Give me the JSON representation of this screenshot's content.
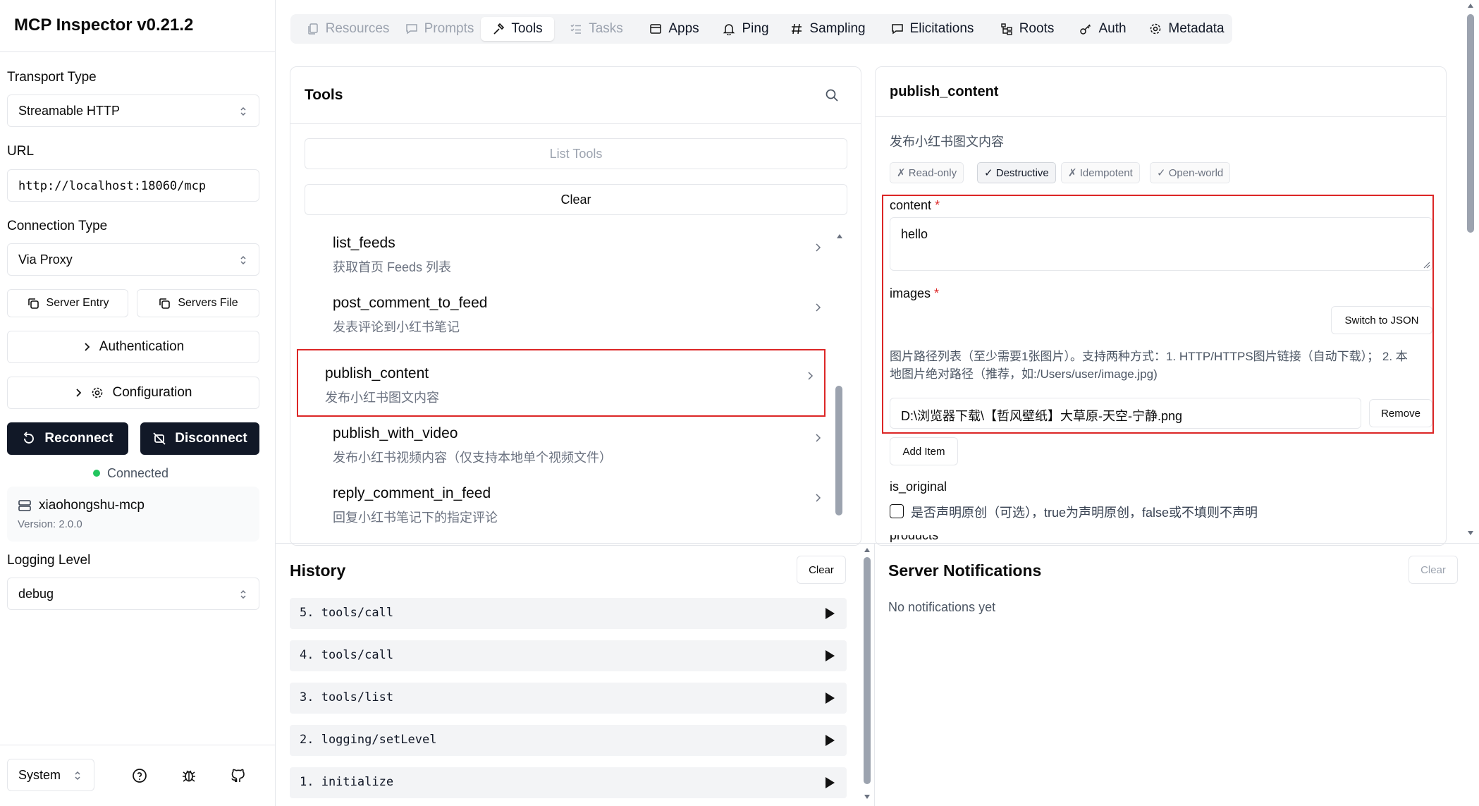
{
  "app": {
    "title": "MCP Inspector v0.21.2"
  },
  "sidebar": {
    "transport_label": "Transport Type",
    "transport_value": "Streamable HTTP",
    "url_label": "URL",
    "url_value": "http://localhost:18060/mcp",
    "connection_label": "Connection Type",
    "connection_value": "Via Proxy",
    "server_entry_label": "Server Entry",
    "servers_file_label": "Servers File",
    "authentication_label": "Authentication",
    "configuration_label": "Configuration",
    "reconnect_label": "Reconnect",
    "disconnect_label": "Disconnect",
    "status_text": "Connected",
    "server_name": "xiaohongshu-mcp",
    "server_version": "Version: 2.0.0",
    "logging_label": "Logging Level",
    "logging_value": "debug",
    "theme_value": "System"
  },
  "tabs": [
    {
      "label": "Resources",
      "icon": "resources-icon",
      "state": "disabled"
    },
    {
      "label": "Prompts",
      "icon": "prompts-icon",
      "state": "disabled"
    },
    {
      "label": "Tools",
      "icon": "hammer-icon",
      "state": "active"
    },
    {
      "label": "Tasks",
      "icon": "tasks-icon",
      "state": "disabled"
    },
    {
      "label": "Apps",
      "icon": "apps-icon",
      "state": "enabled"
    },
    {
      "label": "Ping",
      "icon": "bell-icon",
      "state": "enabled"
    },
    {
      "label": "Sampling",
      "icon": "hash-icon",
      "state": "enabled"
    },
    {
      "label": "Elicitations",
      "icon": "message-icon",
      "state": "enabled"
    },
    {
      "label": "Roots",
      "icon": "folder-tree-icon",
      "state": "enabled"
    },
    {
      "label": "Auth",
      "icon": "key-icon",
      "state": "enabled"
    },
    {
      "label": "Metadata",
      "icon": "gear-icon",
      "state": "enabled"
    }
  ],
  "tools_panel": {
    "title": "Tools",
    "list_button": "List Tools",
    "clear_button": "Clear",
    "items": [
      {
        "name": "list_feeds",
        "desc": "获取首页 Feeds 列表"
      },
      {
        "name": "post_comment_to_feed",
        "desc": "发表评论到小红书笔记"
      },
      {
        "name": "publish_content",
        "desc": "发布小红书图文内容"
      },
      {
        "name": "publish_with_video",
        "desc": "发布小红书视频内容（仅支持本地单个视频文件）"
      },
      {
        "name": "reply_comment_in_feed",
        "desc": "回复小红书笔记下的指定评论"
      }
    ]
  },
  "detail": {
    "title": "publish_content",
    "description": "发布小红书图文内容",
    "annotations": [
      {
        "label": "✗ Read-only",
        "on": false
      },
      {
        "label": "✓ Destructive",
        "on": true
      },
      {
        "label": "✗ Idempotent",
        "on": false
      },
      {
        "label": "✓ Open-world",
        "on": false
      }
    ],
    "content_label": "content",
    "required_mark": "*",
    "content_value": "hello",
    "images_label": "images",
    "switch_json_label": "Switch to JSON",
    "images_desc_line1": "图片路径列表（至少需要1张图片）。支持两种方式：1. HTTP/HTTPS图片链接（自动下载）； 2. 本",
    "images_desc_line2": "地图片绝对路径（推荐，如:/Users/user/image.jpg)",
    "image_item_value": "D:\\浏览器下载\\【哲风壁纸】大草原-天空-宁静.png",
    "remove_label": "Remove",
    "add_item_label": "Add Item",
    "is_original_label": "is_original",
    "is_original_desc": "是否声明原创（可选），true为声明原创，false或不填则不声明",
    "is_original_checked": false,
    "partial_label": "products"
  },
  "history": {
    "title": "History",
    "clear_label": "Clear",
    "items": [
      "5. tools/call",
      "4. tools/call",
      "3. tools/list",
      "2. logging/setLevel",
      "1. initialize"
    ]
  },
  "notifications": {
    "title": "Server Notifications",
    "clear_label": "Clear",
    "empty_text": "No notifications yet"
  },
  "colors": {
    "highlight_border": "#dc2626",
    "dark_button": "#111827",
    "connected_dot": "#22c55e"
  }
}
